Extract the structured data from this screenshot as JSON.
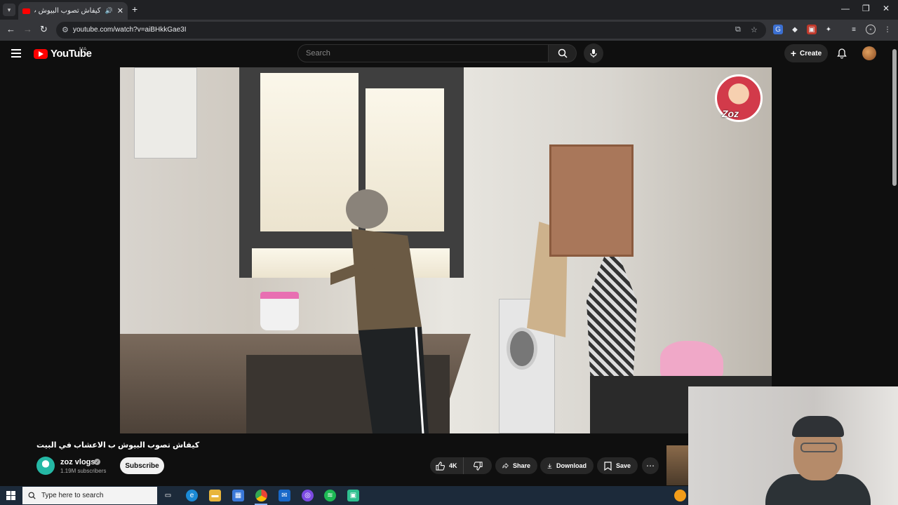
{
  "browser": {
    "tab_title": "كيفاش تصوب البيوش ب الأ",
    "url": "youtube.com/watch?v=aiBHkkGae3I",
    "window_controls": [
      "minimize",
      "restore",
      "close"
    ]
  },
  "youtube": {
    "logo_text": "YouTube",
    "country_code": "MA",
    "search_placeholder": "Search",
    "create_label": "Create"
  },
  "video": {
    "title": "كيفاش تصوب البيوش ب الاعشاب في البيت",
    "overlay_logo_text": "Zoz",
    "channel": {
      "name": "zoz vlogs",
      "subscribers": "1.19M subscribers"
    },
    "subscribe_label": "Subscribe",
    "actions": {
      "likes": "4K",
      "share": "Share",
      "download": "Download",
      "save": "Save"
    }
  },
  "taskbar": {
    "search_placeholder": "Type here to search",
    "icons": [
      "task-view-icon",
      "edge-icon",
      "file-explorer-icon",
      "store-icon",
      "chrome-icon",
      "mail-icon",
      "app-icon",
      "spotify-icon",
      "app2-icon"
    ]
  },
  "colors": {
    "youtube_red": "#ff0000",
    "background": "#0f0f0f",
    "pill": "#272727"
  }
}
